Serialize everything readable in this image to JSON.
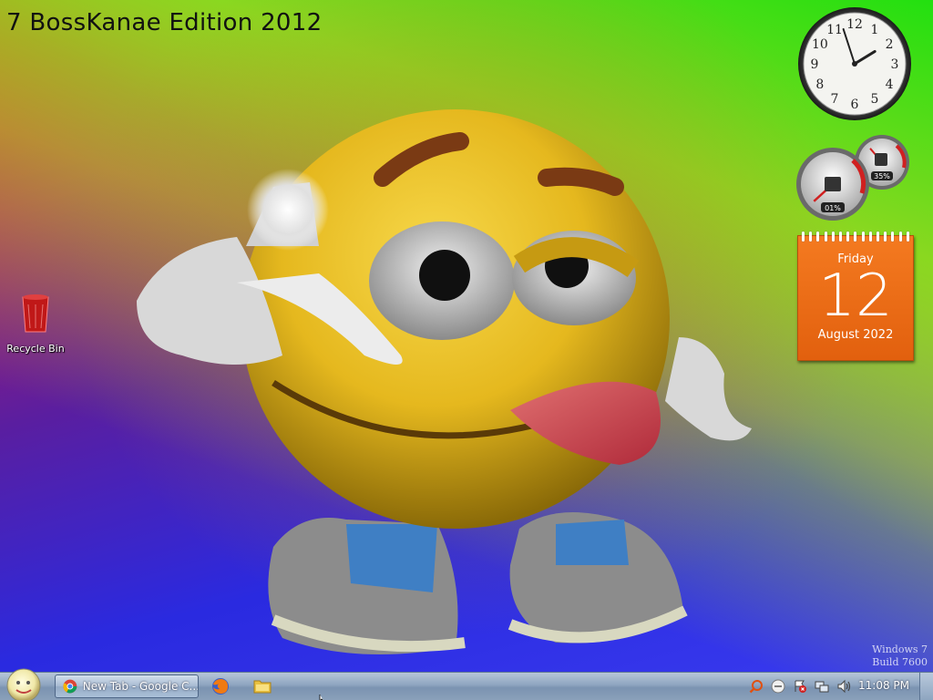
{
  "desktop": {
    "edition_title": "7 BossKanae Edition 2012",
    "icons": [
      {
        "label": "Recycle Bin",
        "icon": "recycle-bin-icon"
      }
    ],
    "watermark": {
      "line1": "Windows 7",
      "line2": "Build 7600"
    }
  },
  "gadgets": {
    "clock": {
      "hours": 1,
      "minutes": 57,
      "numerals": [
        "12",
        "1",
        "2",
        "3",
        "4",
        "5",
        "6",
        "7",
        "8",
        "9",
        "10",
        "11"
      ]
    },
    "cpu_meter": {
      "cpu_label": "01%",
      "memory_label": "35%",
      "cpu_value": 1,
      "memory_value": 35
    },
    "calendar": {
      "weekday": "Friday",
      "day": "12",
      "month_year": "August 2022"
    }
  },
  "taskbar": {
    "start_icon": "start-orb-icon",
    "active_task": {
      "label": "New Tab - Google C...",
      "icon": "chrome-icon"
    },
    "pinned": [
      {
        "name": "firefox",
        "icon": "firefox-icon"
      },
      {
        "name": "explorer",
        "icon": "folder-icon"
      }
    ],
    "tray": {
      "icons": [
        "search-icon",
        "messenger-icon",
        "action-center-icon",
        "network-icon",
        "volume-icon"
      ],
      "time": "11:08 PM"
    }
  },
  "colors": {
    "calendar_orange": "#f47a20",
    "taskbar": "#8ea5c0"
  }
}
